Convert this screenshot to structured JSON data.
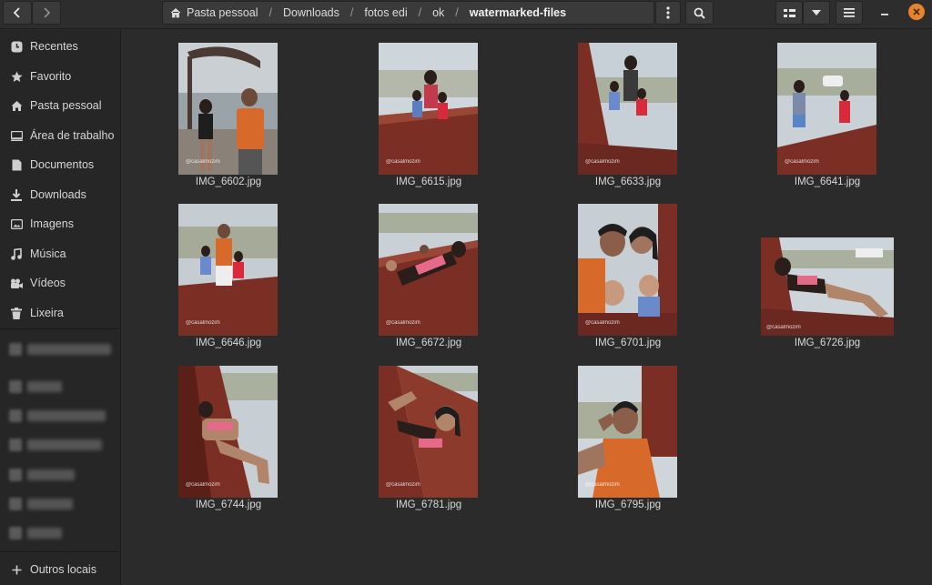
{
  "header": {
    "breadcrumbs": [
      "Pasta pessoal",
      "Downloads",
      "fotos edi",
      "ok",
      "watermarked-files"
    ],
    "separator": "/"
  },
  "sidebar": {
    "items": [
      {
        "label": "Recentes",
        "icon": "clock-icon"
      },
      {
        "label": "Favorito",
        "icon": "star-icon"
      },
      {
        "label": "Pasta pessoal",
        "icon": "home-icon"
      },
      {
        "label": "Área de trabalho",
        "icon": "desktop-icon"
      },
      {
        "label": "Documentos",
        "icon": "document-icon"
      },
      {
        "label": "Downloads",
        "icon": "download-icon"
      },
      {
        "label": "Imagens",
        "icon": "image-icon"
      },
      {
        "label": "Música",
        "icon": "music-icon"
      },
      {
        "label": "Vídeos",
        "icon": "video-icon"
      },
      {
        "label": "Lixeira",
        "icon": "trash-icon"
      }
    ],
    "other_locations": {
      "label": "Outros locais",
      "icon": "plus-icon"
    }
  },
  "files": [
    {
      "name": "IMG_6602.jpg",
      "watermark": "@casalmozim",
      "orientation": "portrait"
    },
    {
      "name": "IMG_6615.jpg",
      "watermark": "@casalmozim",
      "orientation": "portrait"
    },
    {
      "name": "IMG_6633.jpg",
      "watermark": "@casalmozim",
      "orientation": "portrait"
    },
    {
      "name": "IMG_6641.jpg",
      "watermark": "@casalmozim",
      "orientation": "portrait"
    },
    {
      "name": "IMG_6646.jpg",
      "watermark": "@casalmozim",
      "orientation": "portrait"
    },
    {
      "name": "IMG_6672.jpg",
      "watermark": "@casalmozim",
      "orientation": "portrait"
    },
    {
      "name": "IMG_6701.jpg",
      "watermark": "@casalmozim",
      "orientation": "portrait"
    },
    {
      "name": "IMG_6726.jpg",
      "watermark": "@casalmozim",
      "orientation": "landscape"
    },
    {
      "name": "IMG_6744.jpg",
      "watermark": "@casalmozim",
      "orientation": "portrait"
    },
    {
      "name": "IMG_6781.jpg",
      "watermark": "@casalmozim",
      "orientation": "portrait"
    },
    {
      "name": "IMG_6795.jpg",
      "watermark": "@casalmozim",
      "orientation": "portrait"
    }
  ],
  "colors": {
    "accent": "#e8832d",
    "sidebar_bg": "#262626",
    "content_bg": "#2b2b2b",
    "wood": "#7a2e24"
  }
}
